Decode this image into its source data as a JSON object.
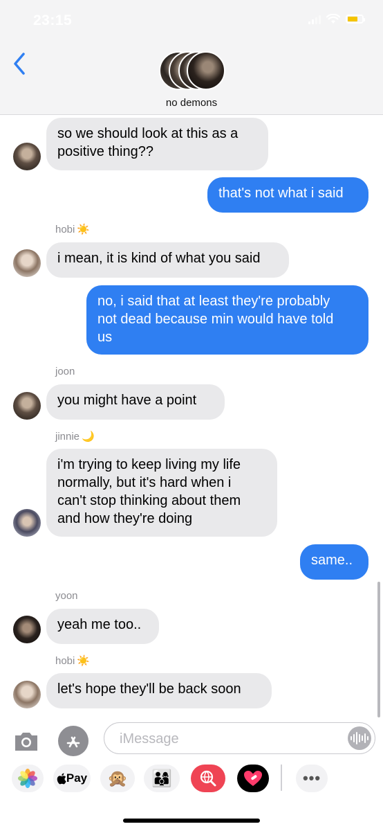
{
  "status_bar": {
    "time": "23:15"
  },
  "header": {
    "group_name": "no demons"
  },
  "messages": [
    {
      "text": "so we should look at this as a positive thing??",
      "lines": [
        "so we should look at this as a",
        "positive thing??"
      ]
    },
    {
      "text": "that's not what i said"
    },
    {
      "sender": "hobi",
      "sender_emoji": "☀️",
      "text": "i mean, it is kind of what you said"
    },
    {
      "lines": [
        "no, i said that at least they're probably",
        "not dead because min would have told",
        "us"
      ]
    },
    {
      "sender": "joon",
      "text": "you might have a point"
    },
    {
      "sender": "jinnie",
      "sender_emoji": "🌙",
      "lines": [
        "i'm trying to keep living my life",
        "normally, but it's hard when i",
        "can't stop thinking about them",
        "and how they're doing"
      ]
    },
    {
      "text": "same.."
    },
    {
      "sender": "yoon",
      "text": "yeah me too.."
    },
    {
      "sender": "hobi",
      "sender_emoji": "☀️",
      "text": "let's hope they'll be back soon"
    }
  ],
  "composer": {
    "placeholder": "iMessage"
  },
  "app_drawer": {
    "pay_label": "Pay",
    "apps": [
      "photos-app",
      "apple-pay-app",
      "memoji-app",
      "stickers-app",
      "images-search-app",
      "digital-touch-app",
      "more-apps"
    ]
  }
}
